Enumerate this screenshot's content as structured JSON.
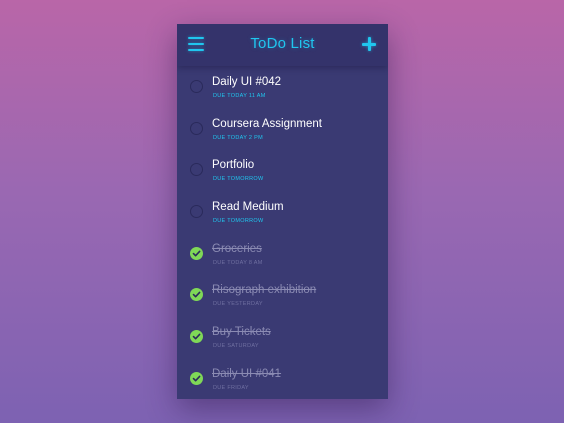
{
  "header": {
    "title": "ToDo List",
    "menu_icon": "hamburger-menu-icon",
    "add_icon": "plus-icon"
  },
  "colors": {
    "accent": "#20c6ef",
    "panel": "#3a3a73",
    "done": "#7fd857"
  },
  "tasks": [
    {
      "title": "Daily UI #042",
      "due": "DUE TODAY 11 AM",
      "done": false
    },
    {
      "title": "Coursera Assignment",
      "due": "DUE TODAY 2 PM",
      "done": false
    },
    {
      "title": "Portfolio",
      "due": "DUE TOMORROW",
      "done": false
    },
    {
      "title": "Read Medium",
      "due": "DUE TOMORROW",
      "done": false
    },
    {
      "title": "Groceries",
      "due": "DUE TODAY 8 AM",
      "done": true
    },
    {
      "title": "Risograph exhibition",
      "due": "DUE YESTERDAY",
      "done": true
    },
    {
      "title": "Buy Tickets",
      "due": "DUE SATURDAY",
      "done": true
    },
    {
      "title": "Daily UI #041",
      "due": "DUE FRIDAY",
      "done": true
    }
  ]
}
